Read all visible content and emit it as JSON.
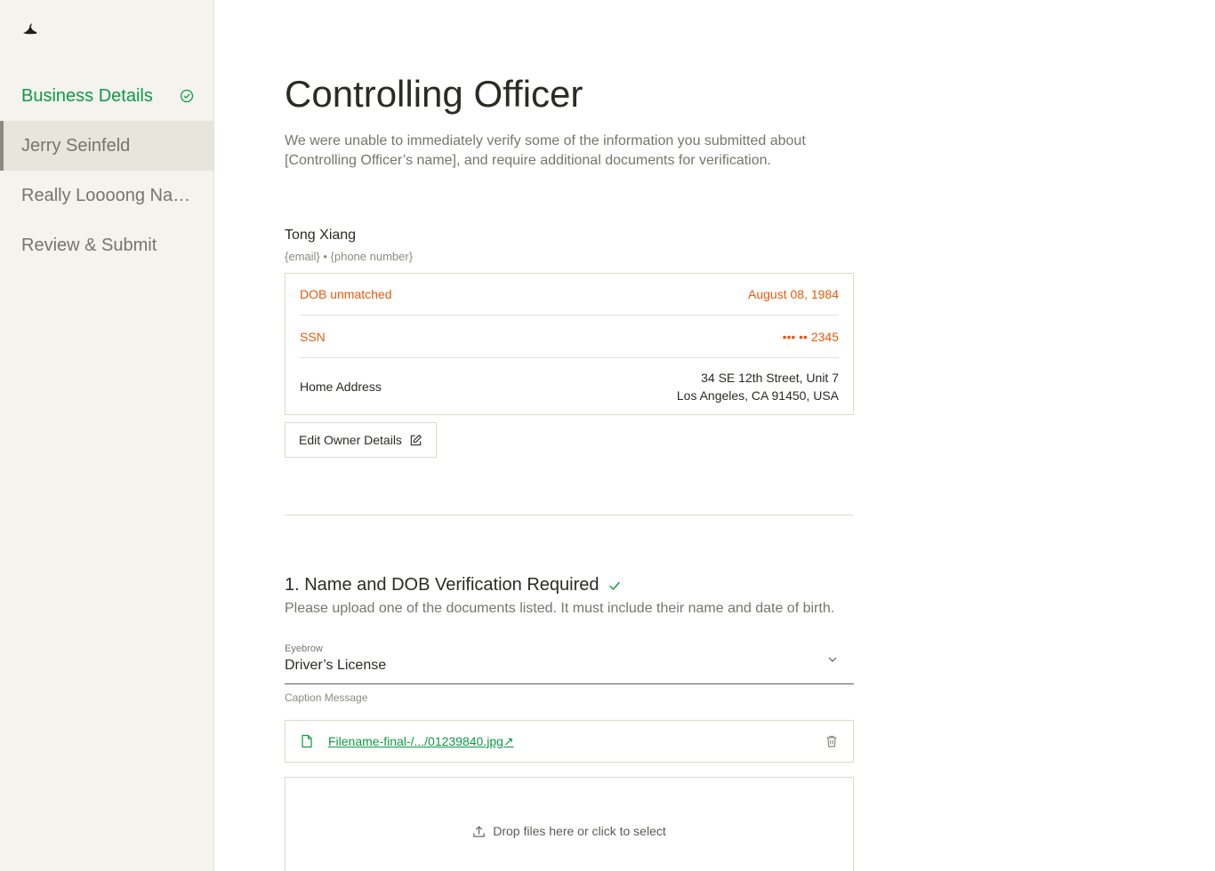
{
  "sidebar": {
    "logo_icon": "bird-logo-icon",
    "items": [
      {
        "label": "Business Details",
        "state": "done",
        "icon": "check-circle-icon"
      },
      {
        "label": "Jerry Seinfeld",
        "state": "active"
      },
      {
        "label": "Really Loooong Name",
        "state": "default"
      },
      {
        "label": "Review & Submit",
        "state": "default"
      }
    ]
  },
  "main": {
    "title": "Controlling Officer",
    "intro": "We were unable to immediately verify some of the information you submitted about [Controlling Officer’s name], and require additional documents for verification.",
    "owner": {
      "name": "Tong Xiang",
      "meta": "{email} • {phone number}",
      "dob_label": "DOB unmatched",
      "dob_value": "August 08, 1984",
      "ssn_label": "SSN",
      "ssn_value": "••• •• 2345",
      "address_label": "Home Address",
      "address_line1": "34 SE 12th Street, Unit 7",
      "address_line2": "Los Angeles, CA 91450, USA"
    },
    "edit_button": "Edit Owner Details",
    "section": {
      "title": "1. Name and DOB Verification Required",
      "description": "Please upload one of the documents listed. It must include their name and date of birth.",
      "select_eyebrow": "Eyebrow",
      "select_value": "Driver’s License",
      "caption": "Caption Message",
      "file_name": "Filename-final-/.../01239840.jpg",
      "dropzone_text": "Drop files here or click to select"
    }
  },
  "colors": {
    "accent_green": "#0d9a46",
    "warning_orange": "#e8590c",
    "sidebar_bg": "#f4f3ee",
    "border": "#d9dcc8"
  }
}
